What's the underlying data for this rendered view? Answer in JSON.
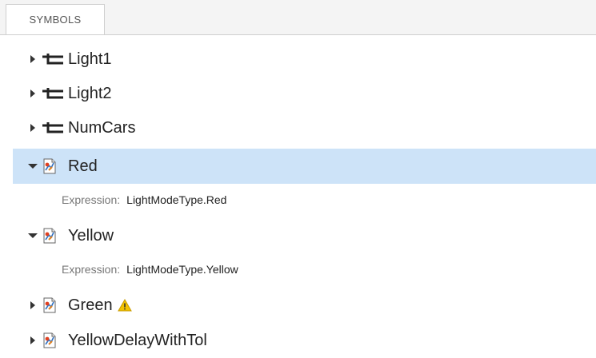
{
  "tab": {
    "label": "SYMBOLS"
  },
  "symbols": [
    {
      "name": "Light1",
      "icon": "signal-icon",
      "expanded": false
    },
    {
      "name": "Light2",
      "icon": "signal-icon",
      "expanded": false
    },
    {
      "name": "NumCars",
      "icon": "signal-icon",
      "expanded": false
    },
    {
      "name": "Red",
      "icon": "parameter-icon",
      "expanded": true,
      "selected": true,
      "expression_label": "Expression:",
      "expression": "LightModeType.Red"
    },
    {
      "name": "Yellow",
      "icon": "parameter-icon",
      "expanded": true,
      "expression_label": "Expression:",
      "expression": "LightModeType.Yellow"
    },
    {
      "name": "Green",
      "icon": "parameter-icon",
      "expanded": false,
      "warning": true
    },
    {
      "name": "YellowDelayWithTol",
      "icon": "parameter-icon",
      "expanded": false
    }
  ],
  "colors": {
    "selection": "#cde3f8",
    "warning": "#f2c200"
  }
}
